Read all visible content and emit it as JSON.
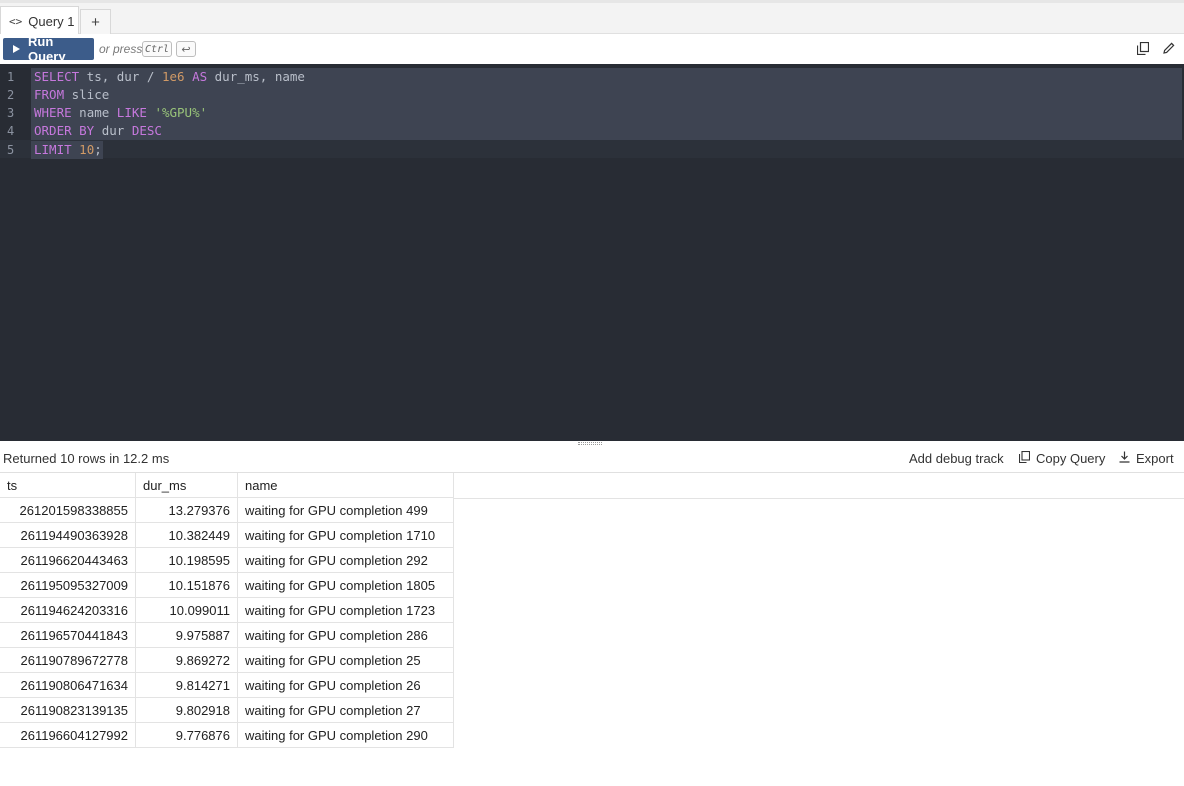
{
  "tabs": [
    {
      "label": "Query 1",
      "icon": "code-icon"
    }
  ],
  "tab_add_label": "+",
  "toolbar": {
    "run_label": "Run Query",
    "or_press": "or press",
    "shortcut_ctrl": "Ctrl",
    "shortcut_enter": "↩"
  },
  "editor": {
    "line_numbers": [
      "1",
      "2",
      "3",
      "4",
      "5"
    ],
    "lines": [
      [
        {
          "t": "SELECT",
          "c": "kw"
        },
        {
          "t": " ts, dur / ",
          "c": ""
        },
        {
          "t": "1e6",
          "c": "numc"
        },
        {
          "t": " ",
          "c": ""
        },
        {
          "t": "AS",
          "c": "kw"
        },
        {
          "t": " dur_ms, name",
          "c": ""
        }
      ],
      [
        {
          "t": "FROM",
          "c": "kw"
        },
        {
          "t": " slice",
          "c": ""
        }
      ],
      [
        {
          "t": "WHERE",
          "c": "kw"
        },
        {
          "t": " name ",
          "c": ""
        },
        {
          "t": "LIKE",
          "c": "kw"
        },
        {
          "t": " ",
          "c": ""
        },
        {
          "t": "'%GPU%'",
          "c": "str"
        }
      ],
      [
        {
          "t": "ORDER BY",
          "c": "kw"
        },
        {
          "t": " dur ",
          "c": ""
        },
        {
          "t": "DESC",
          "c": "kw"
        }
      ],
      [
        {
          "t": "LIMIT",
          "c": "kw"
        },
        {
          "t": " ",
          "c": ""
        },
        {
          "t": "10",
          "c": "numc"
        },
        {
          "t": ";",
          "c": ""
        }
      ]
    ]
  },
  "results": {
    "status": "Returned 10 rows in 12.2 ms",
    "add_debug_track": "Add debug track",
    "copy_query": "Copy Query",
    "export": "Export",
    "columns": [
      "ts",
      "dur_ms",
      "name"
    ],
    "rows": [
      [
        "261201598338855",
        "13.279376",
        "waiting for GPU completion 499"
      ],
      [
        "261194490363928",
        "10.382449",
        "waiting for GPU completion 1710"
      ],
      [
        "261196620443463",
        "10.198595",
        "waiting for GPU completion 292"
      ],
      [
        "261195095327009",
        "10.151876",
        "waiting for GPU completion 1805"
      ],
      [
        "261194624203316",
        "10.099011",
        "waiting for GPU completion 1723"
      ],
      [
        "261196570441843",
        "9.975887",
        "waiting for GPU completion 286"
      ],
      [
        "261190789672778",
        "9.869272",
        "waiting for GPU completion 25"
      ],
      [
        "261190806471634",
        "9.814271",
        "waiting for GPU completion 26"
      ],
      [
        "261190823139135",
        "9.802918",
        "waiting for GPU completion 27"
      ],
      [
        "261196604127992",
        "9.776876",
        "waiting for GPU completion 290"
      ]
    ]
  },
  "colors": {
    "run_button": "#3c5c8a",
    "editor_bg": "#282c34",
    "keyword": "#c678dd",
    "string": "#98c379",
    "number": "#d19a66"
  }
}
